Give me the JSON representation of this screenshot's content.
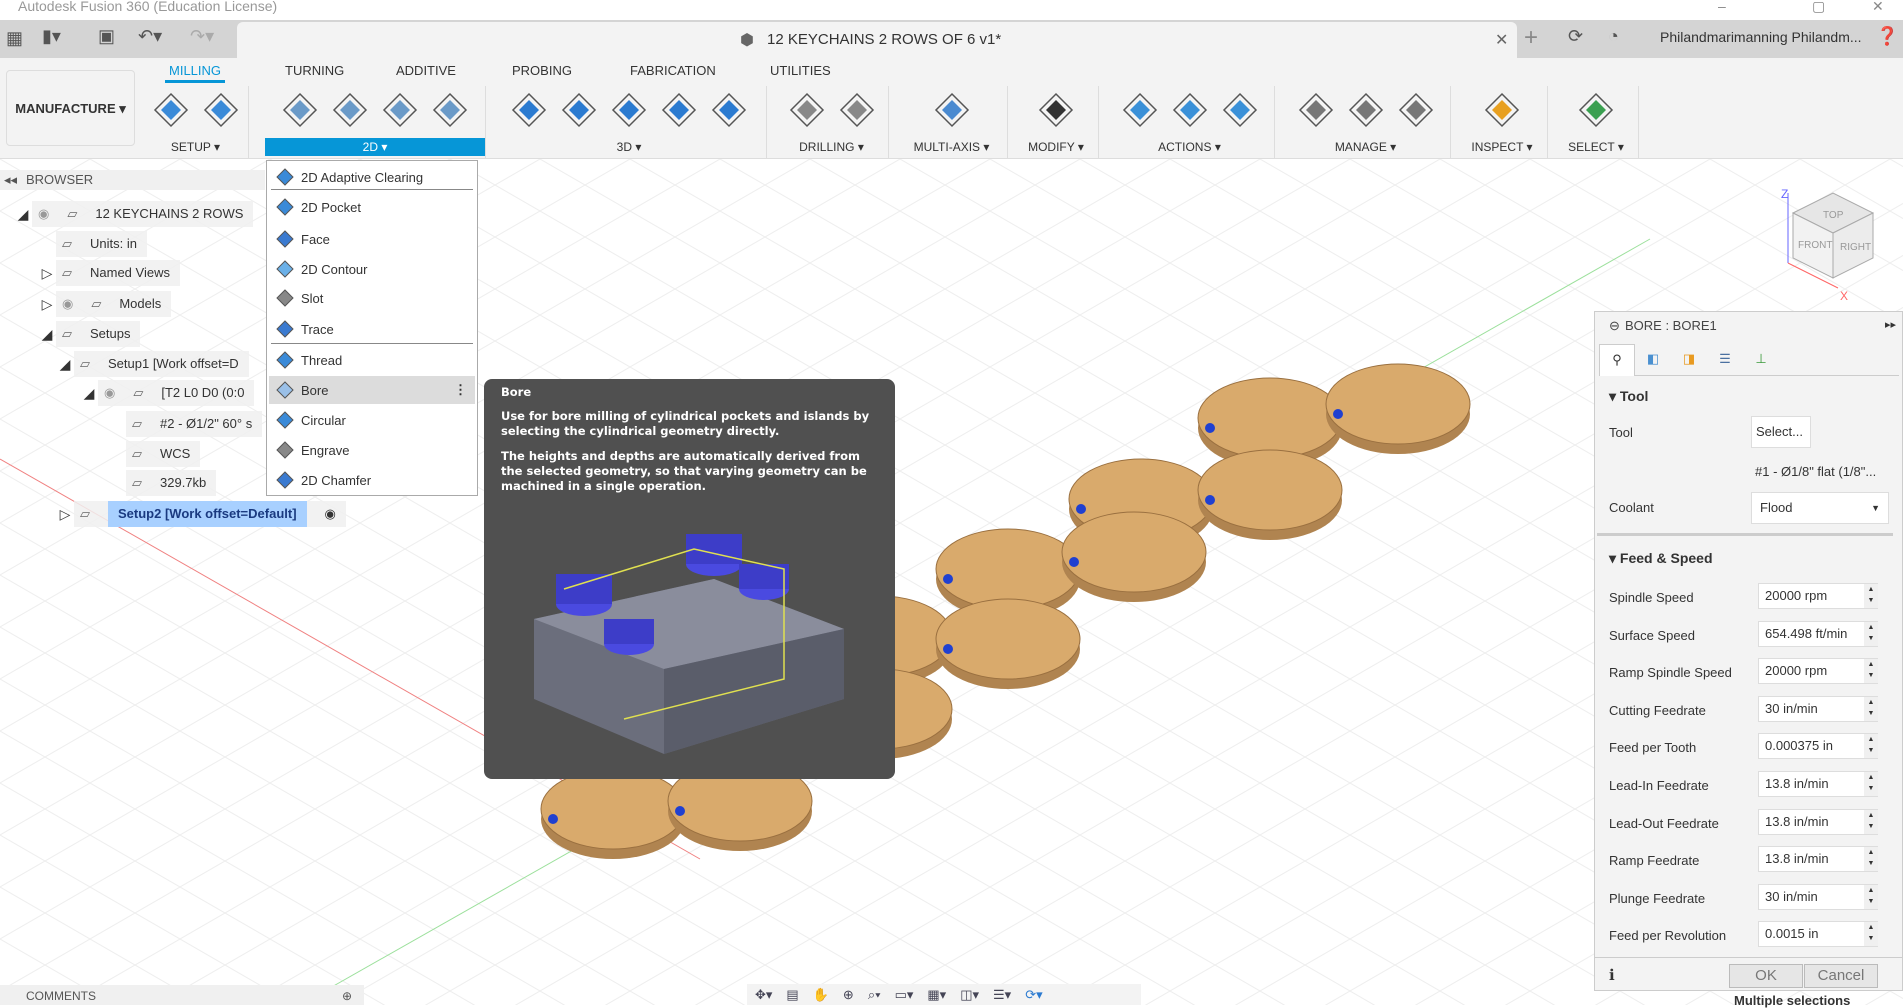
{
  "app_title": "Autodesk Fusion 360 (Education License)",
  "document_title": "12 KEYCHAINS 2 ROWS OF 6 v1*",
  "user_name": "Philandmarimanning Philandm...",
  "workspace": "MANUFACTURE",
  "ribbon_tabs": [
    "MILLING",
    "TURNING",
    "ADDITIVE",
    "PROBING",
    "FABRICATION",
    "UTILITIES"
  ],
  "active_tab": "MILLING",
  "ribbon_groups": [
    {
      "label": "SETUP ▾",
      "icons": [
        "new-folder-icon",
        "nc-program-icon"
      ]
    },
    {
      "label": "2D ▾",
      "icons": [
        "2d-adaptive-icon",
        "2d-pocket-icon",
        "2d-contour-icon",
        "engrave-icon"
      ]
    },
    {
      "label": "3D ▾",
      "icons": [
        "3d-adaptive-icon",
        "3d-pocket-icon",
        "parallel-icon",
        "contour-3d-icon",
        "scallop-icon"
      ]
    },
    {
      "label": "DRILLING ▾",
      "icons": [
        "drill-icon",
        "hole-recognition-icon"
      ]
    },
    {
      "label": "MULTI-AXIS ▾",
      "icons": [
        "swarf-icon"
      ]
    },
    {
      "label": "MODIFY ▾",
      "icons": [
        "scissors-icon"
      ]
    },
    {
      "label": "ACTIONS ▾",
      "icons": [
        "simulate-icon",
        "post-process-icon",
        "setup-sheet-icon"
      ]
    },
    {
      "label": "MANAGE ▾",
      "icons": [
        "tool-library-icon",
        "machine-library-icon",
        "task-manager-icon"
      ]
    },
    {
      "label": "INSPECT ▾",
      "icons": [
        "measure-icon"
      ]
    },
    {
      "label": "SELECT ▾",
      "icons": [
        "select-icon"
      ]
    }
  ],
  "browser": {
    "title": "BROWSER",
    "items": [
      {
        "label": "12 KEYCHAINS 2 ROWS",
        "icon": "component-icon"
      },
      {
        "label": "Units: in",
        "icon": "document-units-icon"
      },
      {
        "label": "Named Views",
        "icon": "folder-icon"
      },
      {
        "label": "Models",
        "icon": "component-icon"
      },
      {
        "label": "Setups",
        "icon": "folder-open-icon"
      },
      {
        "label": "Setup1 [Work offset=D",
        "icon": "folder-open-icon"
      },
      {
        "label": "[T2 L0 D0 (0:0",
        "icon": "engrave-icon"
      },
      {
        "label": "#2 - Ø1/2\" 60° s",
        "icon": "tool-icon"
      },
      {
        "label": "WCS",
        "icon": "wcs-icon"
      },
      {
        "label": "329.7kb",
        "icon": "size-icon"
      },
      {
        "label": "Setup2 [Work offset=Default]",
        "icon": "folder-open-icon"
      }
    ]
  },
  "menu_2d": {
    "items": [
      "2D Adaptive Clearing",
      "2D Pocket",
      "Face",
      "2D Contour",
      "Slot",
      "Trace",
      "Thread",
      "Bore",
      "Circular",
      "Engrave",
      "2D Chamfer"
    ],
    "hovered": "Bore"
  },
  "tooltip": {
    "title": "Bore",
    "p1": "Use for bore milling of cylindrical pockets and islands by selecting the cylindrical geometry directly.",
    "p2": "The heights and depths are automatically derived from the selected geometry, so that varying geometry can be machined in a single operation."
  },
  "panel": {
    "title": "BORE : BORE1",
    "tool_section": "Tool",
    "tool_label": "Tool",
    "tool_button": "Select...",
    "tool_name": "#1 - Ø1/8\" flat (1/8\"...",
    "coolant_label": "Coolant",
    "coolant_value": "Flood",
    "feed_section": "Feed & Speed",
    "fields": [
      {
        "label": "Spindle Speed",
        "value": "20000 rpm"
      },
      {
        "label": "Surface Speed",
        "value": "654.498 ft/min"
      },
      {
        "label": "Ramp Spindle Speed",
        "value": "20000 rpm"
      },
      {
        "label": "Cutting Feedrate",
        "value": "30 in/min"
      },
      {
        "label": "Feed per Tooth",
        "value": "0.000375 in"
      },
      {
        "label": "Lead-In Feedrate",
        "value": "13.8 in/min"
      },
      {
        "label": "Lead-Out Feedrate",
        "value": "13.8 in/min"
      },
      {
        "label": "Ramp Feedrate",
        "value": "13.8 in/min"
      },
      {
        "label": "Plunge Feedrate",
        "value": "30 in/min"
      },
      {
        "label": "Feed per Revolution",
        "value": "0.0015 in"
      }
    ],
    "ok": "OK",
    "cancel": "Cancel",
    "status": "Multiple selections"
  },
  "comments": "COMMENTS",
  "viewcube": {
    "top": "TOP",
    "front": "FRONT",
    "right": "RIGHT",
    "z": "Z",
    "x": "X"
  },
  "colors": {
    "accent": "#0696d7",
    "tooltip_bg": "#505050",
    "keychain": "#d9aa6c",
    "selection": "#a8d0ff"
  }
}
